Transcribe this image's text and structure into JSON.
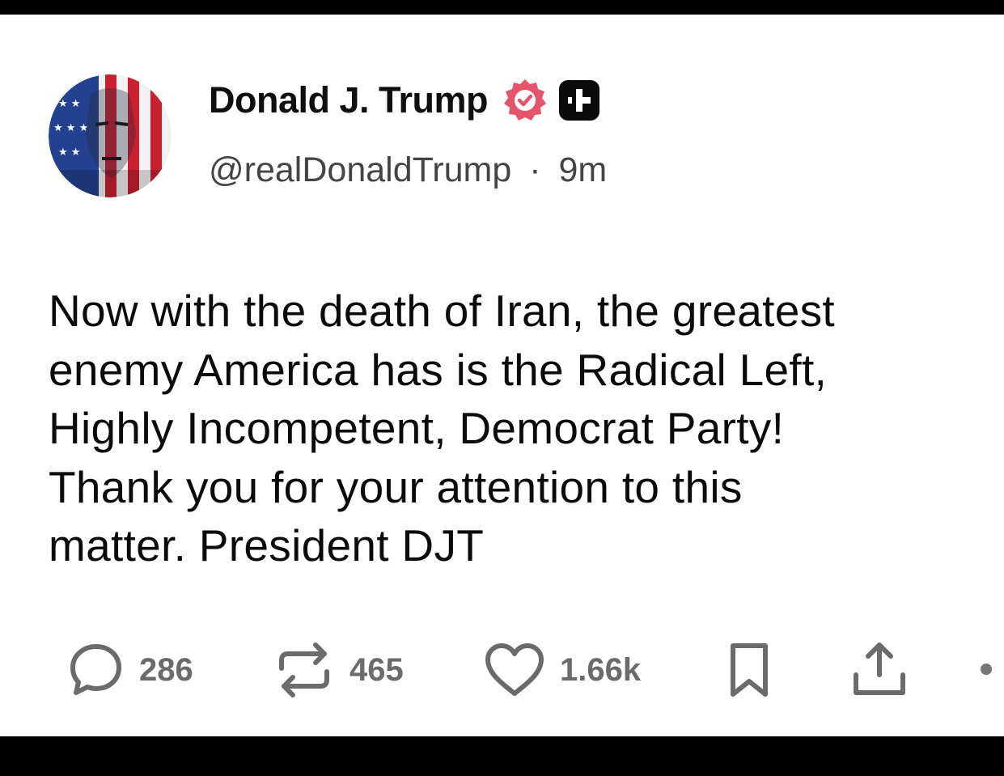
{
  "author": {
    "display_name": "Donald J. Trump",
    "handle": "@realDonaldTrump",
    "separator": "·",
    "time_ago": "9m"
  },
  "post": {
    "lines": [
      "Now with the death of Iran, the greatest",
      "enemy America has is the Radical Left,",
      "Highly Incompetent, Democrat Party!",
      "Thank you for your attention to this",
      "matter. President DJT"
    ]
  },
  "actions": {
    "replies": "286",
    "reposts": "465",
    "likes": "1.66k"
  },
  "icons": {
    "verified": "verified-badge-icon",
    "plus": "plus-badge-icon",
    "reply": "reply-icon",
    "repost": "repost-icon",
    "like": "heart-icon",
    "bookmark": "bookmark-icon",
    "share": "share-icon"
  },
  "colors": {
    "verified": "#e2556b",
    "icon_gray": "#6b6b6b",
    "text": "#0b0b0b"
  }
}
